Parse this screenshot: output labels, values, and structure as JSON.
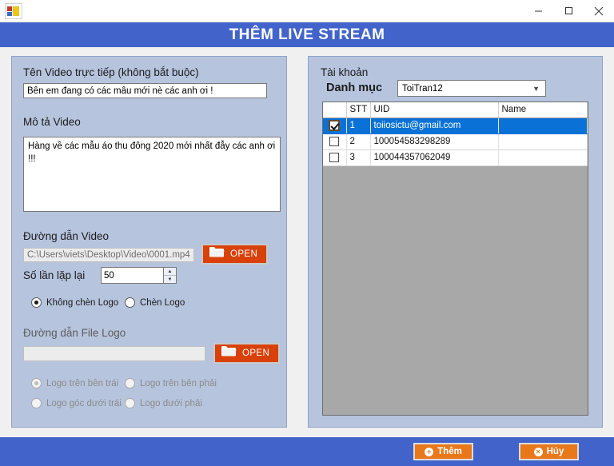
{
  "window": {
    "app_icon": "visual-studio-app-icon",
    "minimize": "minimize-icon",
    "maximize": "maximize-icon",
    "close": "close-icon"
  },
  "header": {
    "title": "THÊM LIVE STREAM",
    "accent": "#4264ca"
  },
  "left_panel": {
    "video_name_label": "Tên Video trực tiếp (không bắt buộc)",
    "video_name_value": "Bên em đang có các mẫu mới nè các anh ơi !",
    "video_desc_label": "Mô tả Video",
    "video_desc_value": "Hàng về các mẫu áo thu đông 2020 mới nhất đẫy các anh ơi !!!",
    "video_path_label": "Đường dẫn Video",
    "video_path_value": "C:\\Users\\viets\\Desktop\\Video\\0001.mp4",
    "open_video_label": "OPEN",
    "repeat_label": "Số lần lặp lại",
    "repeat_value": "50",
    "logo_mode": [
      {
        "label": "Không chèn Logo",
        "checked": true,
        "disabled": false
      },
      {
        "label": "Chèn Logo",
        "checked": false,
        "disabled": false
      }
    ],
    "logo_path_label": "Đường dẫn File Logo",
    "logo_path_value": "",
    "open_logo_label": "OPEN",
    "logo_positions": [
      {
        "label": "Logo trên bên trái",
        "checked": true,
        "disabled": true
      },
      {
        "label": "Logo trên bên phải",
        "checked": false,
        "disabled": true
      },
      {
        "label": "Logo góc dưới trái",
        "checked": false,
        "disabled": true
      },
      {
        "label": "Logo dưới phải",
        "checked": false,
        "disabled": true
      }
    ]
  },
  "right_panel": {
    "account_label": "Tài khoản",
    "category_label": "Danh mục",
    "category_value": "ToiTran12",
    "grid": {
      "columns": [
        "",
        "STT",
        "UID",
        "Name"
      ],
      "rows": [
        {
          "checked": true,
          "stt": "1",
          "uid": "toiiosictu@gmail.com",
          "name": "",
          "selected": true
        },
        {
          "checked": false,
          "stt": "2",
          "uid": "100054583298289",
          "name": "",
          "selected": false
        },
        {
          "checked": false,
          "stt": "3",
          "uid": "100044357062049",
          "name": "",
          "selected": false
        }
      ]
    }
  },
  "footer": {
    "add_label": "Thêm",
    "add_icon": "plus-circle-icon",
    "cancel_label": "Hủy",
    "cancel_icon": "close-circle-icon",
    "button_color": "#e8781a"
  }
}
